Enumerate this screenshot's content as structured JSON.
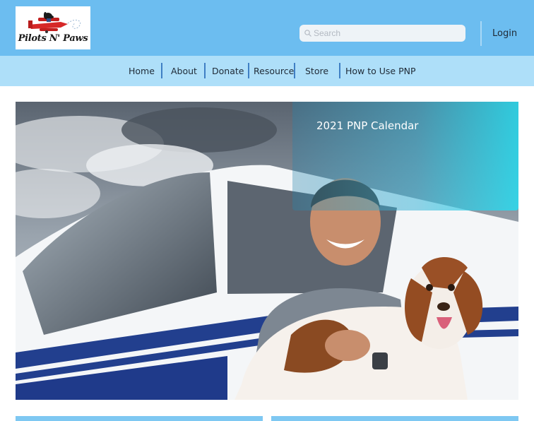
{
  "brand": {
    "logo_text": "Pilots N' Paws"
  },
  "search": {
    "placeholder": "Search",
    "value": ""
  },
  "header": {
    "login_label": "Login"
  },
  "nav": {
    "items": [
      {
        "label": "Home"
      },
      {
        "label": "About"
      },
      {
        "label": "Donate"
      },
      {
        "label": "Resource"
      },
      {
        "label": "Store"
      },
      {
        "label": "How to Use PNP"
      }
    ]
  },
  "hero": {
    "promo_title": "2021 PNP Calendar"
  },
  "colors": {
    "header_bg": "#6cbdf0",
    "nav_bg": "#aedff9",
    "accent": "#3f7fc4",
    "card_bg": "#7ec8f2"
  },
  "icons": {
    "search": "search-icon",
    "logo": "plane-dog-logo"
  }
}
